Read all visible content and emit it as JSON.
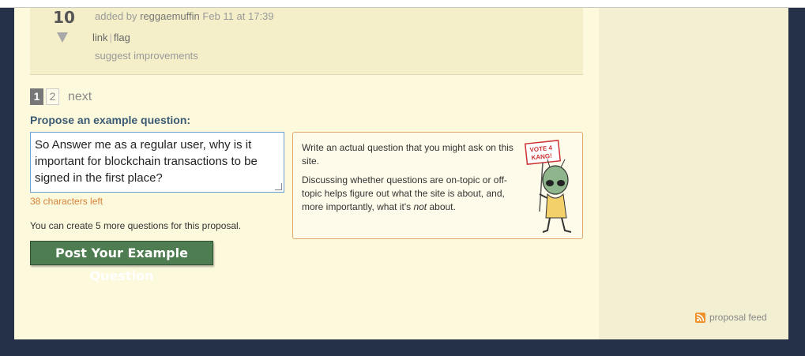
{
  "answer": {
    "vote_count": "10",
    "added_by_prefix": "added by",
    "author": "reggaemuffin",
    "timestamp": "Feb 11 at 17:39",
    "link_label": "link",
    "flag_label": "flag",
    "suggest_label": "suggest improvements"
  },
  "pager": {
    "current": "1",
    "other": "2",
    "next_label": "next"
  },
  "propose": {
    "label": "Propose an example question:",
    "input_value": "So Answer me as a regular user, why is it important for blockchain transactions to be signed in the first place?",
    "chars_left": "38 characters left",
    "remaining_note": "You can create 5 more questions for this proposal.",
    "submit_label": "Post Your Example Question"
  },
  "tip": {
    "line1": "Write an actual question that you might ask on this site.",
    "line2_before": "Discussing whether questions are on-topic or off-topic helps figure out what the site is about, and, more importantly, what it's ",
    "line2_emph": "not",
    "line2_after": " about.",
    "sign_text_1": "VOTE 4",
    "sign_text_2": "KANG!"
  },
  "sidebar": {
    "feed_label": "proposal feed",
    "feed_icon": "rss-icon"
  },
  "colors": {
    "frame": "#243149",
    "main_bg": "#fdf9dc",
    "sidebar_bg": "#f3efd3",
    "button": "#4e7d52",
    "heading": "#3a5a74",
    "warning": "#d6833a",
    "tip_border": "#e2a76b"
  }
}
